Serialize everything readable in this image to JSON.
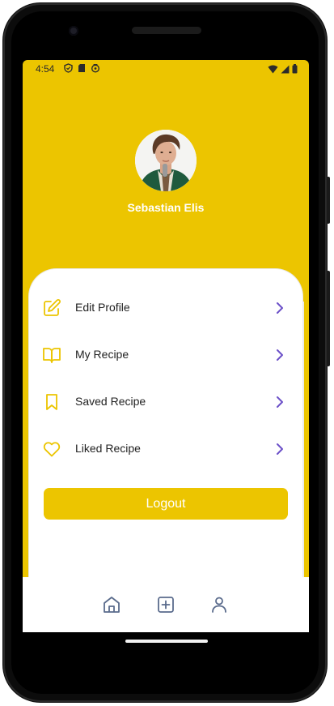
{
  "status_bar": {
    "time": "4:54"
  },
  "profile": {
    "name": "Sebastian Elis"
  },
  "menu": {
    "items": [
      {
        "label": "Edit Profile",
        "icon": "edit-icon"
      },
      {
        "label": "My Recipe",
        "icon": "book-icon"
      },
      {
        "label": "Saved Recipe",
        "icon": "bookmark-icon"
      },
      {
        "label": "Liked Recipe",
        "icon": "heart-icon"
      }
    ],
    "logout_label": "Logout"
  },
  "bottom_nav": {
    "items": [
      {
        "icon": "home-icon"
      },
      {
        "icon": "add-icon"
      },
      {
        "icon": "profile-icon"
      }
    ]
  },
  "colors": {
    "accent": "#ecc500",
    "chevron": "#6b4fc8",
    "nav_icon": "#5a6b8c"
  }
}
